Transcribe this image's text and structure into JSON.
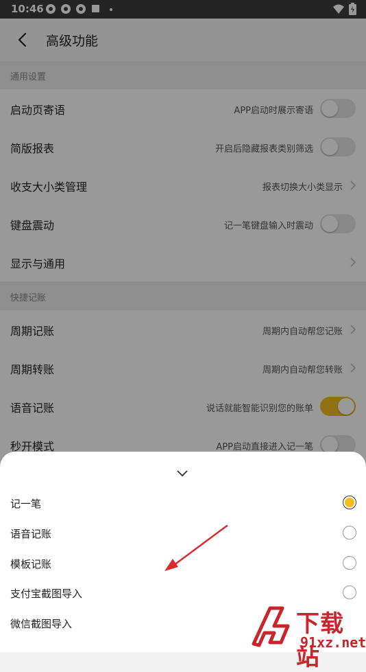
{
  "status_bar": {
    "time": "10:46"
  },
  "header": {
    "title": "高级功能"
  },
  "sections": {
    "general": "通用设置",
    "quick": "快捷记账"
  },
  "rows": [
    {
      "label": "启动页寄语",
      "desc": "APP启动时展示寄语",
      "control": "toggle",
      "on": false
    },
    {
      "label": "简版报表",
      "desc": "开启后隐藏报表类别筛选",
      "control": "toggle",
      "on": false
    },
    {
      "label": "收支大小类管理",
      "desc": "报表切换大小类显示",
      "control": "arrow"
    },
    {
      "label": "键盘震动",
      "desc": "记一笔键盘输入时震动",
      "control": "toggle",
      "on": false
    },
    {
      "label": "显示与通用",
      "desc": "",
      "control": "arrow"
    },
    {
      "label": "周期记账",
      "desc": "周期内自动帮您记账",
      "control": "arrow"
    },
    {
      "label": "周期转账",
      "desc": "周期内自动帮您转账",
      "control": "arrow"
    },
    {
      "label": "语音记账",
      "desc": "说话就能智能识别您的账单",
      "control": "toggle",
      "on": true
    },
    {
      "label": "秒开模式",
      "desc": "APP启动直接进入记一笔",
      "control": "toggle",
      "on": false
    }
  ],
  "sheet": {
    "options": [
      {
        "label": "记一笔",
        "selected": true
      },
      {
        "label": "语音记账",
        "selected": false
      },
      {
        "label": "模板记账",
        "selected": false
      },
      {
        "label": "支付宝截图导入",
        "selected": false
      },
      {
        "label": "微信截图导入",
        "selected": false
      }
    ]
  },
  "watermark": {
    "text_main": "下载站",
    "text_url": "91xz.net"
  },
  "colors": {
    "accent": "#f2bd1d",
    "annotation_arrow": "#d92b2b",
    "watermark": "#c8262d"
  }
}
